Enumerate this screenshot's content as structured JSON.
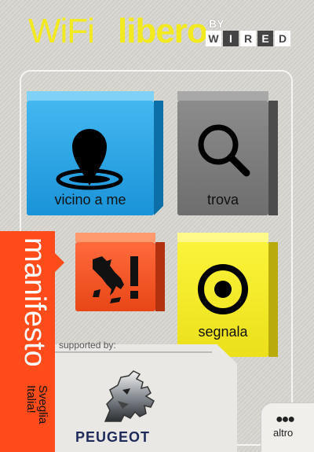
{
  "header": {
    "logo_wifi": "WiFi",
    "logo_libero": "libero",
    "logo_by": "BY",
    "logo_wired_letters": [
      "W",
      "I",
      "R",
      "E",
      "D"
    ]
  },
  "tiles": [
    {
      "label": "vicino a me",
      "icon": "location-pin-icon",
      "color": "#2aa6ea"
    },
    {
      "label": "trova",
      "icon": "search-icon",
      "color": "#7a7a7a"
    },
    {
      "label": "",
      "icon": "italy-exclamation-icon",
      "color": "#f45420"
    },
    {
      "label": "segnala",
      "icon": "target-icon",
      "color": "#f4ea2a"
    }
  ],
  "manifesto": {
    "title": "manifesto",
    "subtitle": "Sveglia Italia!"
  },
  "sponsor": {
    "supported_label": "supported by:",
    "brand": "PEUGEOT",
    "logo_icon": "peugeot-lion-icon"
  },
  "more": {
    "icon": "more-dots-icon",
    "label": "altro"
  }
}
